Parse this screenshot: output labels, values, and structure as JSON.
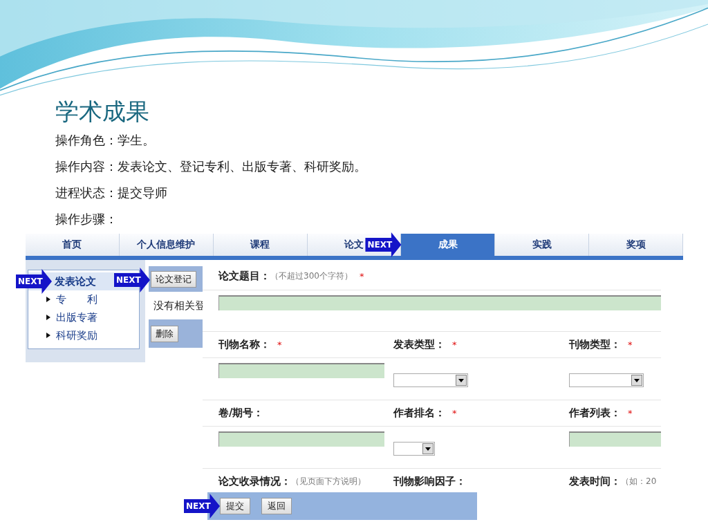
{
  "slide": {
    "title": "学术成果",
    "lines": [
      "操作角色：学生。",
      "操作内容：发表论文、登记专利、出版专著、科研奖励。",
      "进程状态：提交导师",
      "操作步骤："
    ]
  },
  "nav": {
    "tabs": [
      {
        "label": "首页",
        "selected": false
      },
      {
        "label": "个人信息维护",
        "selected": false
      },
      {
        "label": "课程",
        "selected": false
      },
      {
        "label": "论文",
        "selected": false
      },
      {
        "label": "成果",
        "selected": true,
        "next": "NEXT"
      },
      {
        "label": "实践",
        "selected": false
      },
      {
        "label": "奖项",
        "selected": false
      }
    ]
  },
  "sidebar": {
    "items": [
      {
        "label": "发表论文",
        "selected": true,
        "next": "NEXT"
      },
      {
        "label": "专　　利",
        "selected": false
      },
      {
        "label": "出版专著",
        "selected": false
      },
      {
        "label": "科研奖励",
        "selected": false
      }
    ]
  },
  "list_panel": {
    "register_button": {
      "label": "论文登记",
      "next": "NEXT"
    },
    "message": "没有相关登",
    "delete_button": "删除"
  },
  "form": {
    "title_field": {
      "label": "论文题目：",
      "hint": "（不超过300个字符）",
      "mark": "*"
    },
    "rows": [
      [
        {
          "label": "刊物名称：",
          "mark": "*",
          "kind": "text"
        },
        {
          "label": "发表类型：",
          "mark": "*",
          "kind": "select"
        },
        {
          "label": "刊物类型：",
          "mark": "*",
          "kind": "select"
        }
      ],
      [
        {
          "label": "卷/期号：",
          "kind": "text"
        },
        {
          "label": "作者排名：",
          "mark": "*",
          "kind": "select-short"
        },
        {
          "label": "作者列表：",
          "mark": "*",
          "kind": "text-edge"
        }
      ],
      [
        {
          "label": "论文收录情况：",
          "hint": "（见页面下方说明）"
        },
        {
          "label": "刊物影响因子："
        },
        {
          "label": "发表时间：",
          "hint": "（如：20"
        }
      ]
    ]
  },
  "bottom_bar": {
    "buttons": [
      {
        "label": "提交",
        "next": "NEXT"
      },
      {
        "label": "返回"
      }
    ]
  }
}
